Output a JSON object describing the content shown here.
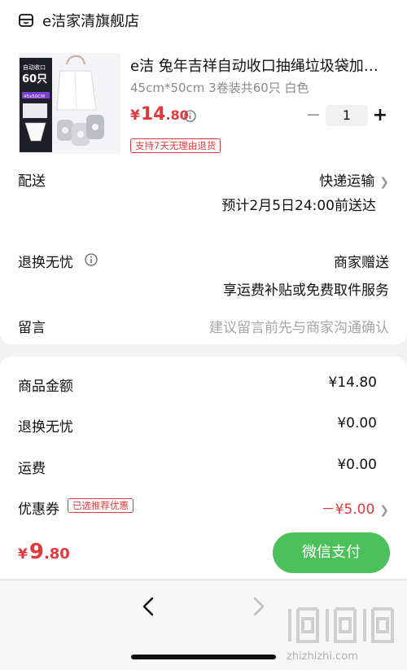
{
  "store": {
    "name": "e洁家清旗舰店",
    "icon": "shop-icon"
  },
  "product": {
    "title": "e洁 兔年吉祥自动收口抽绳垃圾袋加…",
    "spec": "45cm*50cm 3卷装共60只 白色",
    "price_currency": "¥",
    "price_int": "14",
    "price_dec": ".80",
    "quantity": "1",
    "minus_label": "−",
    "plus_label": "+",
    "return_badge": "支持7天无理由退货",
    "image_text": {
      "line1": "自动收口",
      "line2": "60只",
      "badge": "45x50CM",
      "tag": "(点卷)"
    }
  },
  "delivery": {
    "label": "配送",
    "method": "快递运输",
    "eta": "预计2月5日24:00前送达"
  },
  "worry_free": {
    "label": "退换无忧",
    "value": "商家赠送",
    "desc": "享运费补贴或免费取件服务"
  },
  "message": {
    "label": "留言",
    "placeholder": "建议留言前先与商家沟通确认"
  },
  "summary": {
    "goods_label": "商品金额",
    "goods_value": "¥14.80",
    "worry_label": "退换无忧",
    "worry_value": "¥0.00",
    "shipping_label": "运费",
    "shipping_value": "¥0.00",
    "coupon_label": "优惠券",
    "coupon_badge": "已选推荐优惠",
    "coupon_value": "－¥5.00"
  },
  "footer": {
    "total_currency": "¥",
    "total_int": "9",
    "total_dec": ".80",
    "pay_label": "微信支付"
  },
  "watermark": {
    "text": "zhizhizhi.com"
  },
  "colors": {
    "accent_red": "#e4393c",
    "wechat_green": "#4cc05a"
  }
}
